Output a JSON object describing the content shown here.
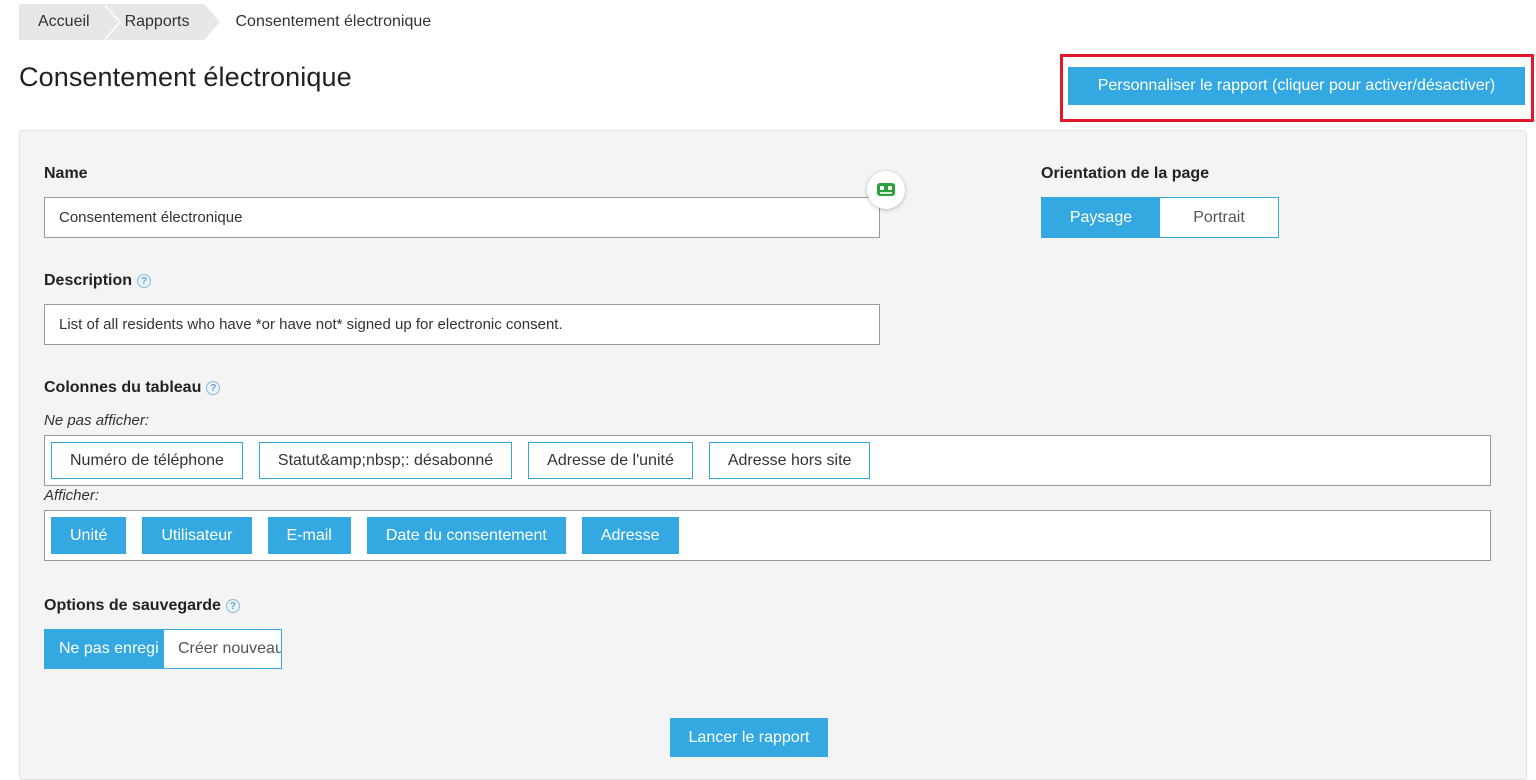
{
  "breadcrumb": {
    "items": [
      "Accueil",
      "Rapports"
    ],
    "current": "Consentement électronique"
  },
  "page": {
    "title": "Consentement électronique",
    "customize_label": "Personnaliser le rapport (cliquer pour activer/désactiver)"
  },
  "form": {
    "name_label": "Name",
    "name_value": "Consentement électronique",
    "description_label": "Description",
    "description_value": "List of all residents who have *or have not* signed up for electronic consent.",
    "orientation_label": "Orientation de la page",
    "orientation_options": [
      "Paysage",
      "Portrait"
    ],
    "orientation_selected": "Paysage",
    "columns_label": "Colonnes du tableau",
    "hidden_label": "Ne pas afficher:",
    "hidden_columns": [
      "Numéro de téléphone",
      "Statut&amp;nbsp;: désabonné",
      "Adresse de l'unité",
      "Adresse hors site"
    ],
    "shown_label": "Afficher:",
    "shown_columns": [
      "Unité",
      "Utilisateur",
      "E-mail",
      "Date du consentement",
      "Adresse"
    ],
    "save_label": "Options de sauvegarde",
    "save_options": [
      "Ne pas enregi",
      "Créer nouveau"
    ],
    "save_selected": "Ne pas enregi",
    "run_label": "Lancer le rapport"
  },
  "colors": {
    "accent": "#34a8e1",
    "highlight_border": "#e4182a",
    "panel_bg": "#f4f4f4"
  },
  "icons": [
    "help-icon",
    "robot-icon"
  ]
}
